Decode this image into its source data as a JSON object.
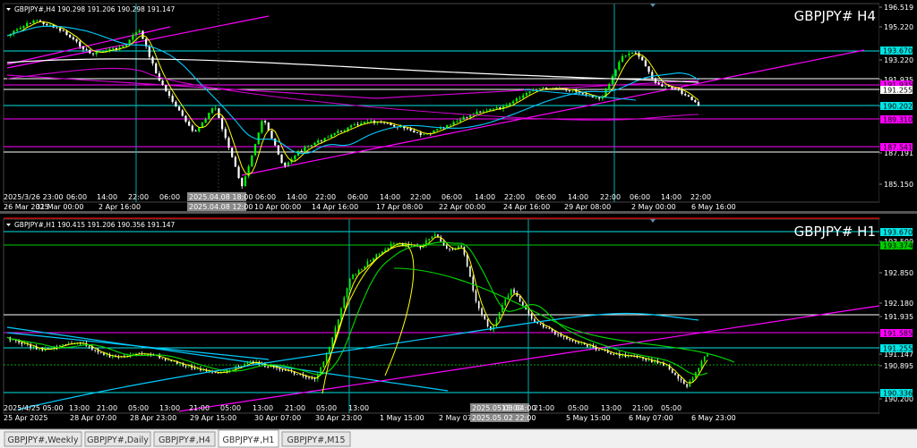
{
  "top": {
    "header": "GBPJPY#,H4  190.298 191.206 190.298 191.147",
    "title": "GBPJPY#  H4",
    "price_ticks": [
      "196.519",
      "195.220",
      "193.220",
      "191.935",
      "190.202",
      "187.191",
      "185.150"
    ],
    "level_tags": [
      {
        "v": "193.670",
        "bg": "#00e5e5",
        "fg": "#000"
      },
      {
        "v": "191.935",
        "bg": "#ff00ff",
        "fg": "#000"
      },
      {
        "v": "191.255",
        "bg": "#ffffff",
        "fg": "#000"
      },
      {
        "v": "190.202",
        "bg": "#00e5e5",
        "fg": "#000"
      },
      {
        "v": "189.310",
        "bg": "#ff00ff",
        "fg": "#000"
      },
      {
        "v": "187.541",
        "bg": "#ff00ff",
        "fg": "#000"
      }
    ],
    "crosshair_label": "2025.04.08 18:00",
    "time_ticks_upper": [
      "2025/3/26 23:00",
      "06:00",
      "14:00",
      "22:00",
      "06:00",
      "2025.04.08 18:00",
      "06:00",
      "14:00",
      "22:00",
      "06:00",
      "14:00",
      "22:00",
      "06:00",
      "14:00",
      "22:00",
      "06:00",
      "14:00",
      "22:00",
      "06:00",
      "14:00",
      "22:00"
    ],
    "time_ticks_lower": [
      "26 Mar 2025",
      "31 Mar 00:00",
      "2 Apr 16:00",
      "2025.04.08 12:00",
      "10 Apr 00:00",
      "14 Apr 16:00",
      "17 Apr 08:00",
      "22 Apr 00:00",
      "24 Apr 16:00",
      "29 Apr 08:00",
      "2 May 00:00",
      "6 May 16:00"
    ]
  },
  "bottom": {
    "header": "GBPJPY#,H1  190.415 191.206 190.356 191.147",
    "title": "GBPJPY#  H1",
    "price_ticks": [
      "193.500",
      "192.850",
      "192.180",
      "191.935",
      "191.147",
      "190.895",
      "190.200"
    ],
    "level_tags": [
      {
        "v": "193.670",
        "bg": "#00e5e5",
        "fg": "#000"
      },
      {
        "v": "193.374",
        "bg": "#00cc00",
        "fg": "#000"
      },
      {
        "v": "191.585",
        "bg": "#ff00ff",
        "fg": "#000"
      },
      {
        "v": "191.255",
        "bg": "#00e5e5",
        "fg": "#000"
      },
      {
        "v": "190.336",
        "bg": "#00e5e5",
        "fg": "#000"
      }
    ],
    "time_ticks_upper": [
      "2025/4/25 05:00",
      "13:00",
      "21:00",
      "05:00",
      "13:00",
      "21:00",
      "05:00",
      "13:00",
      "21:00",
      "05:00",
      "13:00",
      "2025.05.03 04:00",
      "13:00",
      "21:00",
      "05:00",
      "13:00",
      "21:00",
      "05:00"
    ],
    "time_ticks_lower": [
      "25 Apr 2025",
      "28 Apr 07:00",
      "28 Apr 23:00",
      "29 Apr 15:00",
      "30 Apr 07:00",
      "30 Apr 23:00",
      "1 May 15:00",
      "2 May 07:00",
      "2025.05.02 22:00",
      "5 May 15:00",
      "6 May 07:00",
      "6 May 23:00"
    ]
  },
  "tabs": [
    {
      "label": "GBPJPY#,Weekly",
      "active": false
    },
    {
      "label": "GBPJPY#,Daily",
      "active": false
    },
    {
      "label": "GBPJPY#,H4",
      "active": false
    },
    {
      "label": "GBPJPY#,H1",
      "active": true
    },
    {
      "label": "GBPJPY#,M15",
      "active": false
    }
  ],
  "colors": {
    "bull": "#00ff00",
    "bear": "#ffffff",
    "ma_fast": "#ffff00",
    "ma_slow": "#00ccff",
    "ma_long": "#ffffff",
    "trend": "#ff00ff"
  }
}
